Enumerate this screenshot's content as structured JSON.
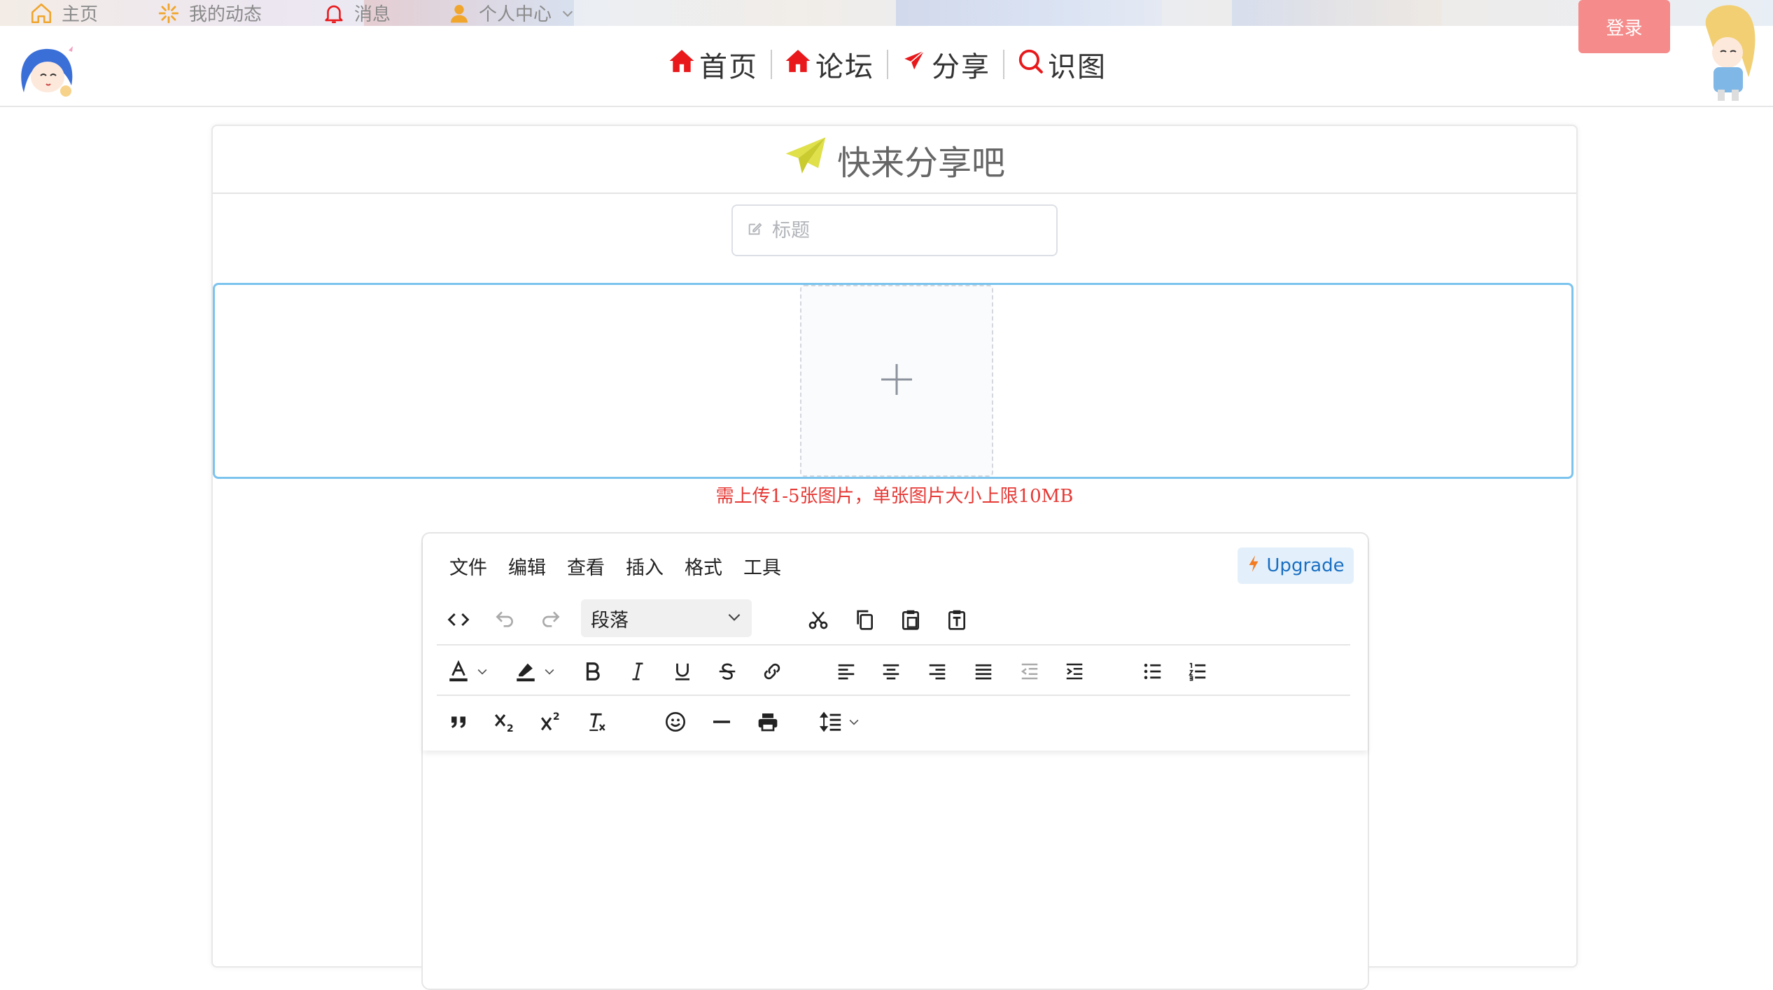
{
  "top_nav": {
    "home": "主页",
    "dynamics": "我的动态",
    "messages": "消息",
    "profile": "个人中心"
  },
  "login_label": "登录",
  "main_nav": [
    {
      "label": "首页",
      "icon": "home-icon"
    },
    {
      "label": "论坛",
      "icon": "home-icon"
    },
    {
      "label": "分享",
      "icon": "paper-plane-icon"
    },
    {
      "label": "识图",
      "icon": "search-icon"
    }
  ],
  "card": {
    "heading": "快来分享吧",
    "title_placeholder": "标题",
    "upload_hint": "需上传1-5张图片，单张图片大小上限10MB"
  },
  "editor": {
    "menu": [
      "文件",
      "编辑",
      "查看",
      "插入",
      "格式",
      "工具"
    ],
    "upgrade_label": "Upgrade",
    "block_format": "段落"
  },
  "colors": {
    "accent_red": "#e8181b",
    "login_bg": "#f58b8b",
    "upload_border": "#7cc4ee",
    "hint_red": "#e53935",
    "plane_yellow": "#dfe04a",
    "upgrade_bg": "#e3f0fb",
    "upgrade_text": "#1a6fc2",
    "nav_icon_orange": "#f0a52c"
  }
}
